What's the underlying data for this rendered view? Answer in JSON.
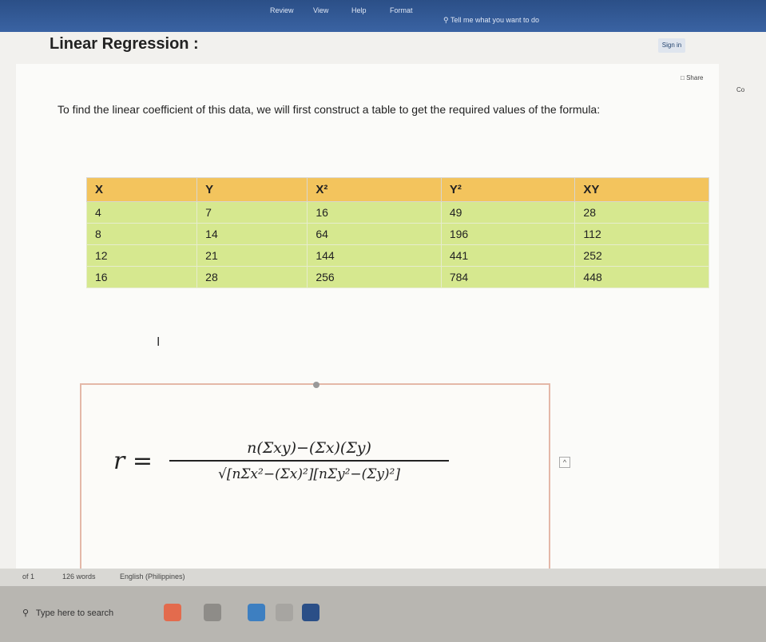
{
  "ribbon": {
    "menu": [
      "Review",
      "View",
      "Help",
      "Format"
    ],
    "tell_me": "Tell me what you want to do",
    "signin": "Sign in",
    "share": "Share",
    "comments": "Co"
  },
  "document": {
    "heading": "Linear Regression :",
    "intro": "To find the linear coefficient of this data, we will first construct a table to get the required values of the formula:",
    "table": {
      "headers": [
        "X",
        "Y",
        "X²",
        "Y²",
        "XY"
      ],
      "rows": [
        [
          "4",
          "7",
          "16",
          "49",
          "28"
        ],
        [
          "8",
          "14",
          "64",
          "196",
          "112"
        ],
        [
          "12",
          "21",
          "144",
          "441",
          "252"
        ],
        [
          "16",
          "28",
          "256",
          "784",
          "448"
        ]
      ]
    },
    "text_cursor": "I",
    "formula": {
      "lhs": "r =",
      "numerator": "n(Σxy)−(Σx)(Σy)",
      "denominator": "√[nΣx²−(Σx)²][nΣy²−(Σy)²]"
    }
  },
  "status": {
    "page": "of 1",
    "words": "126 words",
    "language": "English (Philippines)"
  },
  "taskbar": {
    "search_placeholder": "Type here to search"
  },
  "colors": {
    "header_fill": "#f3c45d",
    "cell_fill": "#d6e88f",
    "ribbon": "#2b4f87"
  }
}
